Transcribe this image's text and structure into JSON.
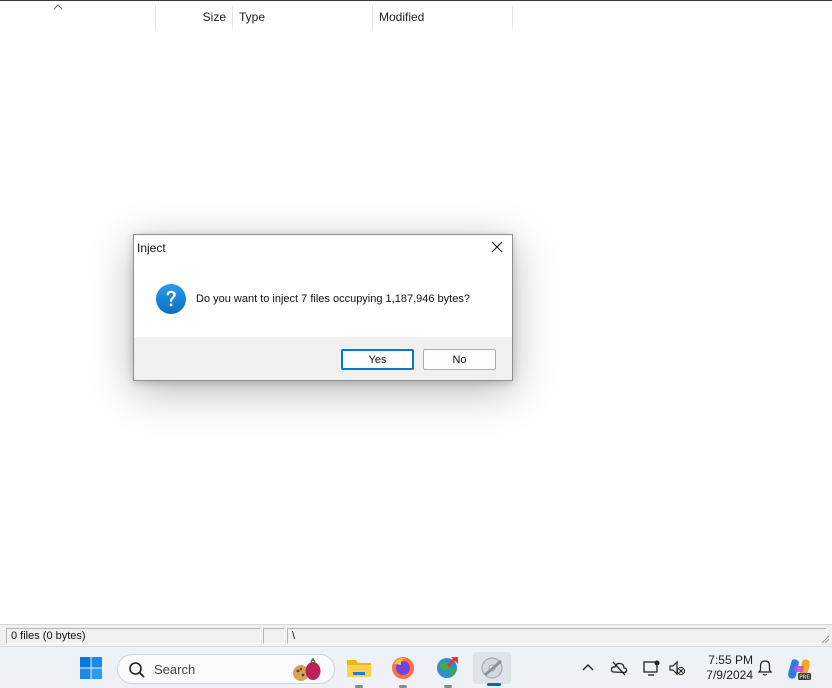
{
  "file_list": {
    "columns": [
      "",
      "Size",
      "Type",
      "Modified"
    ]
  },
  "status_bar": {
    "files_summary": "0 files (0 bytes)",
    "middle": "",
    "path": "\\"
  },
  "dialog": {
    "title": "Inject",
    "message": "Do you want to inject 7 files occupying 1,187,946 bytes?",
    "icon": "question-icon",
    "yes_label": "Yes",
    "no_label": "No"
  },
  "taskbar": {
    "search_placeholder": "Search",
    "apps": [
      "start-icon",
      "file-explorer-icon",
      "firefox-icon",
      "globe-download-icon",
      "inject-app-icon"
    ],
    "clock": {
      "time": "7:55 PM",
      "date": "7/9/2024"
    }
  },
  "colors": {
    "accent": "#0078d4",
    "taskbar_bg": "#eef1f6",
    "dialog_bg": "#f0f0f0"
  }
}
